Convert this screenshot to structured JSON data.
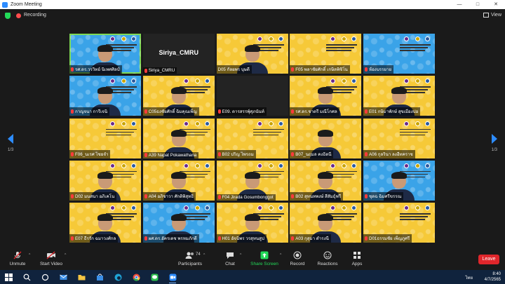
{
  "window": {
    "title": "Zoom Meeting",
    "controls": [
      "—",
      "□",
      "✕"
    ]
  },
  "topbar": {
    "recording_label": "Recording",
    "view_label": "View"
  },
  "pagination": {
    "left": "1/3",
    "right": "1/3"
  },
  "tiles": [
    {
      "name": "รศ.ดร.วรวิทย์ นิเทศศิลป์",
      "style": "blue",
      "speaking": true,
      "muted": true,
      "banner": true,
      "person": true
    },
    {
      "name": "Siriya_CMRU",
      "style": "dark",
      "center_label": "Siriya_CMRU",
      "muted": true,
      "banner": false,
      "person": false
    },
    {
      "name": "D05 กัลยพร  บุษดี",
      "style": "yellow",
      "muted": false,
      "banner": true,
      "person": true
    },
    {
      "name": "F05 พลาชัยศักดิ์ เกษิลพิชิโน",
      "style": "yellow",
      "muted": true,
      "banner": true,
      "person": false
    },
    {
      "name": "ห้องบรรยาย",
      "style": "blue",
      "muted": true,
      "banner": true,
      "person": false
    },
    {
      "name": "กาญจนา  การีเจนิ",
      "style": "blue",
      "muted": true,
      "banner": true,
      "person": true
    },
    {
      "name": "C05ธงชัยศักดิ์  ฉิมคุณเพ็ญ",
      "style": "yellow",
      "muted": true,
      "banner": true,
      "person": true
    },
    {
      "name": "E09. ดารสรรพุ์ศุภนันท์",
      "style": "dark",
      "muted": true,
      "banner": false,
      "person": false
    },
    {
      "name": "รศ.ดร.ชาตรี มณีโกศล",
      "style": "yellow",
      "muted": true,
      "banner": true,
      "person": true
    },
    {
      "name": "E01 กษิมาพักษ์ สุขเมืองปอ",
      "style": "yellow",
      "muted": true,
      "banner": true,
      "person": true
    },
    {
      "name": "F06_นเรศ  ไชยจำ",
      "style": "yellow",
      "muted": true,
      "banner": true,
      "person": false
    },
    {
      "name": "A39 Napat Pokawathana",
      "style": "yellow",
      "muted": true,
      "banner": true,
      "person": true
    },
    {
      "name": "B02 ปริญ  ไพรถม",
      "style": "yellow",
      "muted": true,
      "banner": true,
      "person": false
    },
    {
      "name": "B07_นฤมล  คงธิดนี",
      "style": "yellow",
      "muted": true,
      "banner": false,
      "person": true
    },
    {
      "name": "A06 กุลรินา ลงอีทคราช",
      "style": "yellow",
      "muted": true,
      "banner": true,
      "person": false
    },
    {
      "name": "D02 มนสนา อภิเคโน",
      "style": "yellow",
      "muted": true,
      "banner": true,
      "person": true
    },
    {
      "name": "A04 อภิชาวา  ศักดิพิสุทธิ",
      "style": "yellow",
      "muted": true,
      "banner": true,
      "person": true
    },
    {
      "name": "F04 Jirada Gosumbonggot",
      "style": "yellow",
      "muted": true,
      "banner": true,
      "person": true
    },
    {
      "name": "B02 สุทนทพงษ์ สีสัมธุ์ฟรี",
      "style": "yellow",
      "muted": true,
      "banner": true,
      "person": true
    },
    {
      "name": "ชุดฉ ฉิมศรีขรรณ",
      "style": "blue",
      "muted": true,
      "banner": true,
      "person": true
    },
    {
      "name": "E07 ธีรรัก  ฉมาวงศ์กล",
      "style": "yellow",
      "muted": true,
      "banner": true,
      "person": true
    },
    {
      "name": "ผศ.ดร.อัครเดช พรหมภักดี",
      "style": "blue",
      "muted": true,
      "banner": true,
      "person": true
    },
    {
      "name": "H01 อัจนิพร  วรสุทนสูป",
      "style": "yellow",
      "muted": true,
      "banner": true,
      "person": true
    },
    {
      "name": "A03 กุสุมา  ดำรงนี",
      "style": "yellow",
      "muted": true,
      "banner": true,
      "person": true
    },
    {
      "name": "D01ธรรมชัย  เพ็ญภูศรี",
      "style": "yellow",
      "muted": true,
      "banner": true,
      "person": false
    }
  ],
  "toolbar": {
    "unmute": "Unmute",
    "start_video": "Start Video",
    "participants": "Participants",
    "participants_count": "74",
    "chat": "Chat",
    "share_screen": "Share Screen",
    "record": "Record",
    "reactions": "Reactions",
    "apps": "Apps",
    "leave": "Leave"
  },
  "taskbar": {
    "language": "ไทย",
    "time": "8:40",
    "date": "4/7/2565"
  },
  "colors": {
    "accent": "#2d8cff",
    "leave": "#e0262b",
    "share": "#23d959",
    "tile_yellow": "#f6c938",
    "tile_blue": "#3aa3e8"
  }
}
